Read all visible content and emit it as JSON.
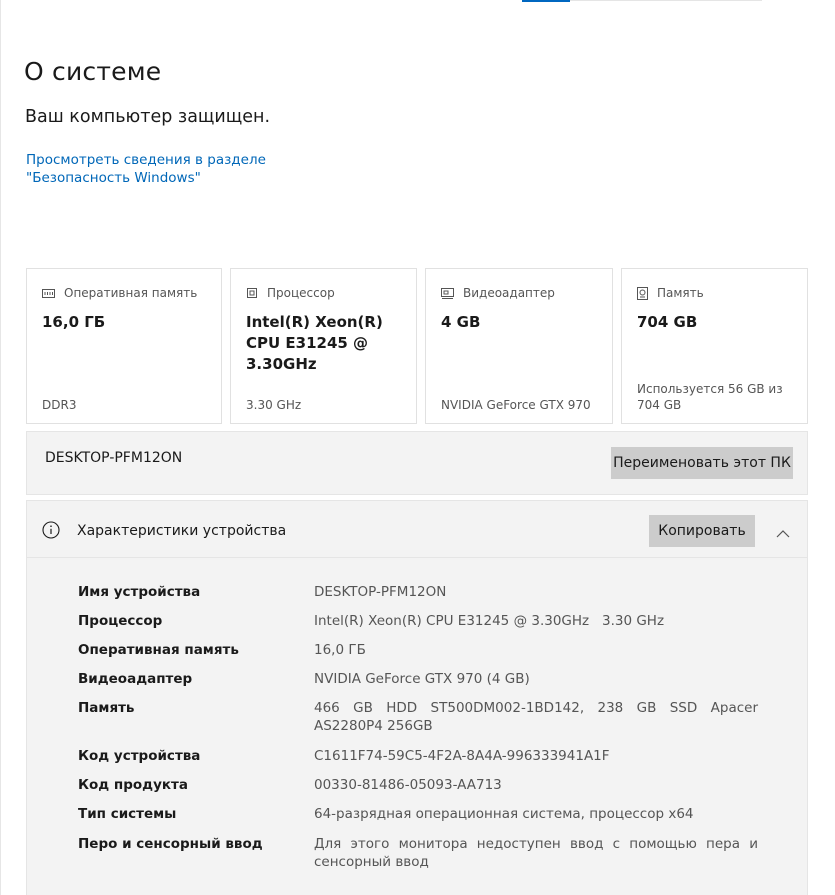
{
  "page": {
    "title": "О системе",
    "protected": "Ваш компьютер защищен.",
    "security_link": "Просмотреть сведения в разделе \"Безопасность Windows\""
  },
  "cards": [
    {
      "icon": "ram-icon",
      "label": "Оперативная память",
      "value": "16,0 ГБ",
      "foot": "DDR3"
    },
    {
      "icon": "cpu-icon",
      "label": "Процессор",
      "value": "Intel(R) Xeon(R) CPU E31245 @ 3.30GHz",
      "foot": "3.30 GHz"
    },
    {
      "icon": "gpu-icon",
      "label": "Видеоадаптер",
      "value": "4 GB",
      "foot": "NVIDIA GeForce GTX 970"
    },
    {
      "icon": "storage-icon",
      "label": "Память",
      "value": "704 GB",
      "foot": "Используется 56 GB из 704 GB"
    }
  ],
  "device": {
    "name": "DESKTOP-PFM12ON",
    "rename_label": "Переименовать этот ПК"
  },
  "specs": {
    "title": "Характеристики устройства",
    "copy_label": "Копировать",
    "rows": [
      {
        "label": "Имя устройства",
        "value": "DESKTOP-PFM12ON"
      },
      {
        "label": "Процессор",
        "value": "Intel(R) Xeon(R) CPU E31245 @ 3.30GHz   3.30 GHz"
      },
      {
        "label": "Оперативная память",
        "value": "16,0 ГБ"
      },
      {
        "label": "Видеоадаптер",
        "value": "NVIDIA GeForce GTX 970 (4 GB)"
      },
      {
        "label": "Память",
        "value": "466 GB HDD ST500DM002-1BD142, 238 GB SSD Apacer AS2280P4 256GB"
      },
      {
        "label": "Код устройства",
        "value": "C1611F74-59C5-4F2A-8A4A-996333941A1F"
      },
      {
        "label": "Код продукта",
        "value": "00330-81486-05093-AA713"
      },
      {
        "label": "Тип системы",
        "value": "64-разрядная операционная система, процессор x64"
      },
      {
        "label": "Перо и сенсорный ввод",
        "value": "Для этого монитора недоступен ввод с помощью пера и сенсорный ввод"
      }
    ]
  },
  "colors": {
    "accent": "#0067c0",
    "link": "#0067b8",
    "panel": "#f3f3f3",
    "button": "#cccccc"
  }
}
